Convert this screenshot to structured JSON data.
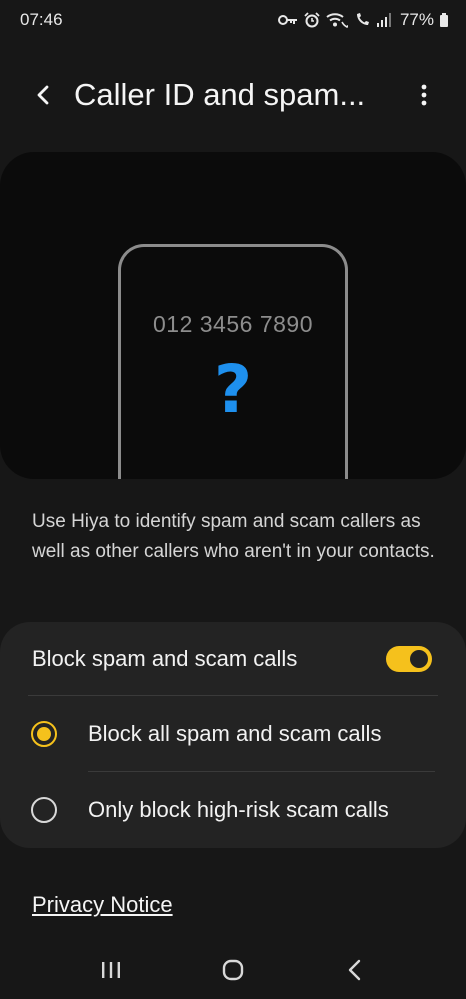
{
  "status_bar": {
    "time": "07:46",
    "battery": "77%",
    "icons": [
      "vpn-key-icon",
      "alarm-icon",
      "wifi-calling-icon",
      "volte-call-icon",
      "signal-icon",
      "battery-icon"
    ]
  },
  "header": {
    "title": "Caller ID and spam...",
    "back_icon": "back-arrow-icon",
    "more_icon": "more-vert-icon"
  },
  "illustration": {
    "phone_number": "012 3456 7890",
    "question_mark": "?",
    "accent_color": "#1e90ee"
  },
  "description": "Use Hiya to identify spam and scam callers as well as other callers who aren't in your contacts.",
  "settings": {
    "toggle_label": "Block spam and scam calls",
    "toggle_on": true,
    "options": [
      {
        "label": "Block all spam and scam calls",
        "selected": true
      },
      {
        "label": "Only block high-risk scam calls",
        "selected": false
      }
    ],
    "accent_color": "#f5c11c"
  },
  "privacy_link": "Privacy Notice",
  "nav_bar": {
    "buttons": [
      "recent-apps-icon",
      "home-icon",
      "back-icon"
    ]
  }
}
